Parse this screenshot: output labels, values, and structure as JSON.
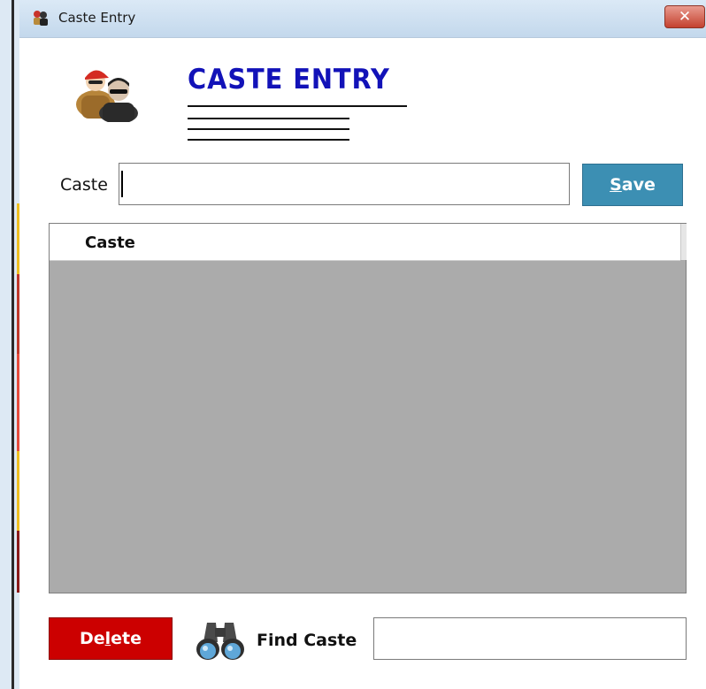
{
  "window": {
    "title": "Caste Entry",
    "close_glyph": "✕"
  },
  "header": {
    "heading": "CASTE ENTRY",
    "logo_icon": "users-icon"
  },
  "form": {
    "caste_label": "Caste",
    "caste_value": "",
    "save_label_underlined": "S",
    "save_label_rest": "ave"
  },
  "grid": {
    "columns": [
      "Caste"
    ],
    "rows": []
  },
  "footer": {
    "delete_label_pre": "De",
    "delete_label_underlined": "l",
    "delete_label_post": "ete",
    "find_label": "Find Caste",
    "find_value": "",
    "find_icon": "binoculars-icon"
  },
  "colors": {
    "heading": "#1212b8",
    "save_button": "#3c8fb3",
    "delete_button": "#cc0000",
    "grid_background": "#ababab"
  }
}
